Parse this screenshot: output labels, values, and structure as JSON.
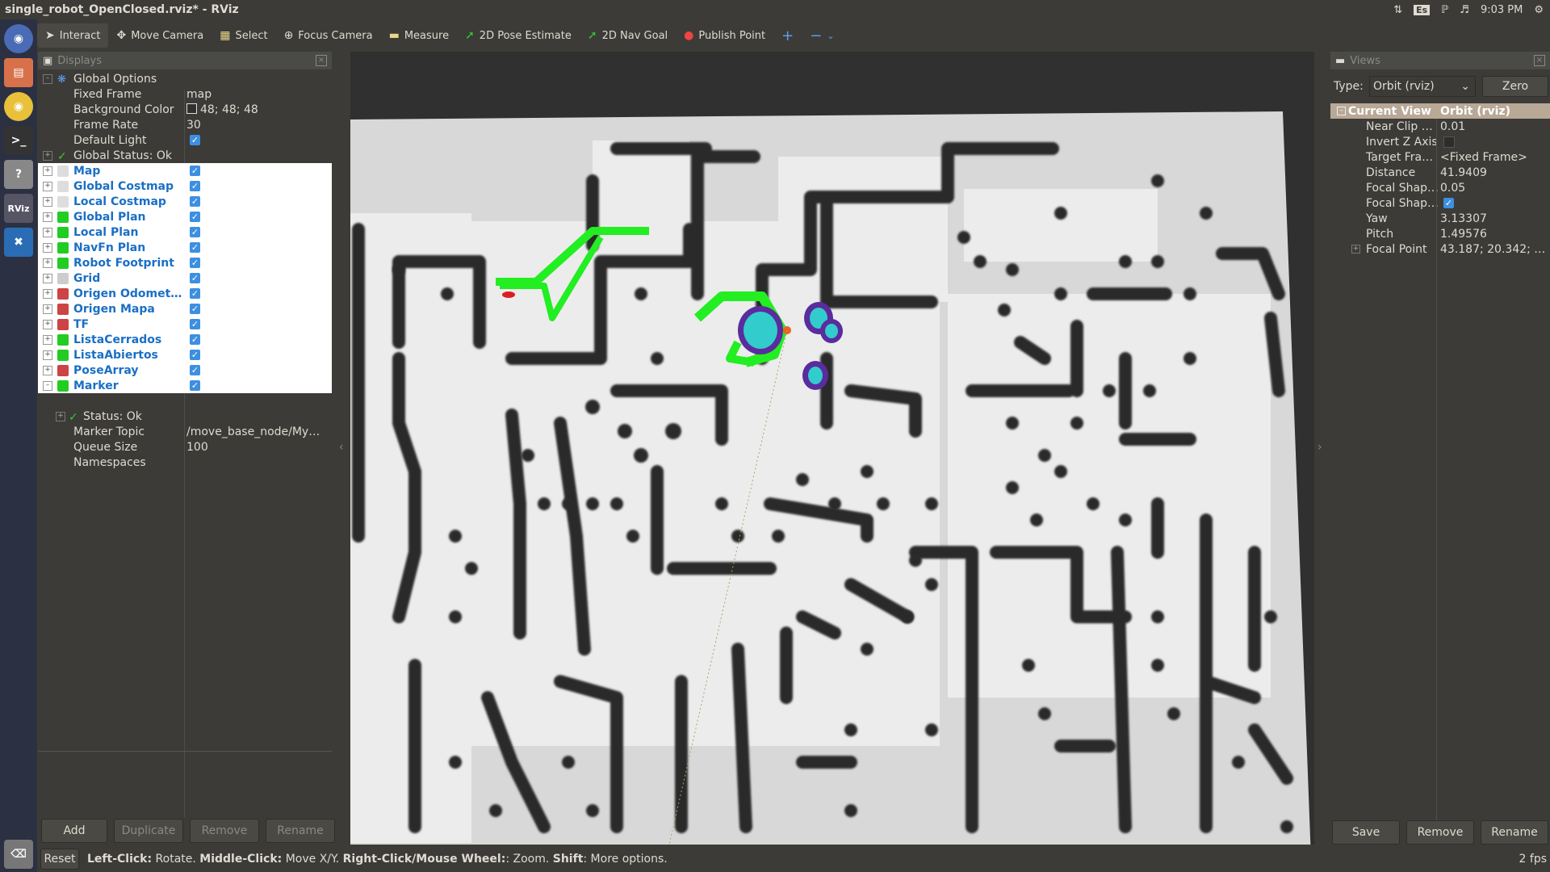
{
  "window": {
    "title": "single_robot_OpenClosed.rviz* - RViz"
  },
  "tray": {
    "lang": "Es",
    "time": "9:03 PM"
  },
  "launcher": {
    "rviz_label": "RViz"
  },
  "toolbar": {
    "interact": "Interact",
    "move_camera": "Move Camera",
    "select": "Select",
    "focus_camera": "Focus Camera",
    "measure": "Measure",
    "pose_estimate": "2D Pose Estimate",
    "nav_goal": "2D Nav Goal",
    "publish_point": "Publish Point",
    "add": "+",
    "remove": "−"
  },
  "displays": {
    "title": "Displays",
    "global_options": {
      "label": "Global Options",
      "fixed_frame": {
        "name": "Fixed Frame",
        "value": "map"
      },
      "background_color": {
        "name": "Background Color",
        "value": "48; 48; 48"
      },
      "frame_rate": {
        "name": "Frame Rate",
        "value": "30"
      },
      "default_light": {
        "name": "Default Light"
      }
    },
    "global_status": "Global Status: Ok",
    "items": [
      {
        "label": "Map",
        "color": "#dddddd"
      },
      {
        "label": "Global Costmap",
        "color": "#dddddd"
      },
      {
        "label": "Local Costmap",
        "color": "#dddddd"
      },
      {
        "label": "Global Plan",
        "color": "#22cc22"
      },
      {
        "label": "Local Plan",
        "color": "#22cc22"
      },
      {
        "label": "NavFn Plan",
        "color": "#22cc22"
      },
      {
        "label": "Robot Footprint",
        "color": "#22cc22"
      },
      {
        "label": "Grid",
        "color": "#cccccc"
      },
      {
        "label": "Origen Odomet…",
        "color": "#cc4444"
      },
      {
        "label": "Origen Mapa",
        "color": "#cc4444"
      },
      {
        "label": "TF",
        "color": "#cc4444"
      },
      {
        "label": "ListaCerrados",
        "color": "#22cc22"
      },
      {
        "label": "ListaAbiertos",
        "color": "#22cc22"
      },
      {
        "label": "PoseArray",
        "color": "#cc4444"
      },
      {
        "label": "Marker",
        "color": "#22cc22"
      }
    ],
    "marker_props": {
      "status": "Status: Ok",
      "topic": {
        "name": "Marker Topic",
        "value": "/move_base_node/My…"
      },
      "queue": {
        "name": "Queue Size",
        "value": "100"
      },
      "namespaces": {
        "name": "Namespaces"
      }
    },
    "buttons": {
      "add": "Add",
      "duplicate": "Duplicate",
      "remove": "Remove",
      "rename": "Rename"
    }
  },
  "views": {
    "title": "Views",
    "type_label": "Type:",
    "type_value": "Orbit (rviz)",
    "zero": "Zero",
    "current_view": {
      "name": "Current View",
      "value": "Orbit (rviz)"
    },
    "props": [
      {
        "name": "Near Clip …",
        "value": "0.01"
      },
      {
        "name": "Invert Z Axis",
        "value": ""
      },
      {
        "name": "Target Fra…",
        "value": "<Fixed Frame>"
      },
      {
        "name": "Distance",
        "value": "41.9409"
      },
      {
        "name": "Focal Shap…",
        "value": "0.05"
      },
      {
        "name": "Focal Shap…",
        "value": ""
      },
      {
        "name": "Yaw",
        "value": "3.13307"
      },
      {
        "name": "Pitch",
        "value": "1.49576"
      },
      {
        "name": "Focal Point",
        "value": "43.187; 20.342; …"
      }
    ],
    "buttons": {
      "save": "Save",
      "remove": "Remove",
      "rename": "Rename"
    }
  },
  "status": {
    "reset": "Reset",
    "lc": "Left-Click:",
    "lc_text": " Rotate. ",
    "mc": "Middle-Click:",
    "mc_text": " Move X/Y. ",
    "rc": "Right-Click/Mouse Wheel:",
    "rc_text": ": Zoom. ",
    "shift": "Shift",
    "shift_text": ": More options.",
    "fps": "2 fps"
  },
  "colors": {
    "plan": "#22ee22",
    "costmap_cyan": "#33cccc",
    "costmap_purple": "#6633aa",
    "obstacle": "#2b2b2b",
    "free": "#e8e8e8"
  }
}
